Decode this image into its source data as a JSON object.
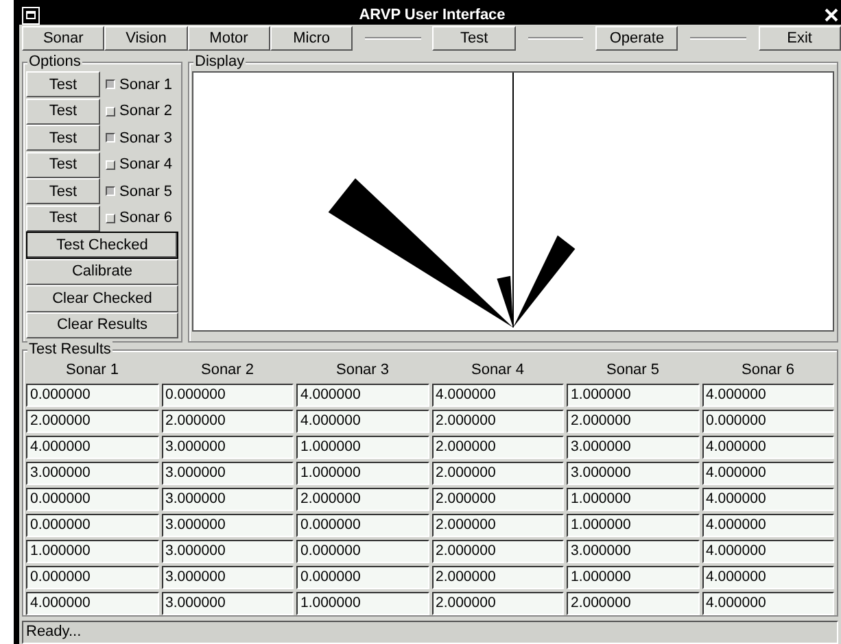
{
  "window": {
    "title": "ARVP User Interface"
  },
  "toolbar": [
    {
      "kind": "button",
      "label": "Sonar"
    },
    {
      "kind": "button",
      "label": "Vision"
    },
    {
      "kind": "button",
      "label": "Motor"
    },
    {
      "kind": "button",
      "label": "Micro"
    },
    {
      "kind": "separator"
    },
    {
      "kind": "button",
      "label": "Test"
    },
    {
      "kind": "separator"
    },
    {
      "kind": "button",
      "label": "Operate"
    },
    {
      "kind": "separator"
    },
    {
      "kind": "button",
      "label": "Exit"
    }
  ],
  "options": {
    "title": "Options",
    "sonars": [
      {
        "button": "Test",
        "label": "Sonar 1",
        "checked": true
      },
      {
        "button": "Test",
        "label": "Sonar 2",
        "checked": false
      },
      {
        "button": "Test",
        "label": "Sonar 3",
        "checked": true
      },
      {
        "button": "Test",
        "label": "Sonar 4",
        "checked": false
      },
      {
        "button": "Test",
        "label": "Sonar 5",
        "checked": true
      },
      {
        "button": "Test",
        "label": "Sonar 6",
        "checked": false
      }
    ],
    "actions": [
      {
        "label": "Test Checked",
        "focused": true
      },
      {
        "label": "Calibrate",
        "focused": false
      },
      {
        "label": "Clear Checked",
        "focused": false
      },
      {
        "label": "Clear Results",
        "focused": false
      }
    ]
  },
  "display": {
    "title": "Display"
  },
  "results": {
    "title": "Test Results",
    "columns": [
      "Sonar 1",
      "Sonar 2",
      "Sonar 3",
      "Sonar 4",
      "Sonar 5",
      "Sonar 6"
    ],
    "rows": [
      [
        "0.000000",
        "0.000000",
        "4.000000",
        "4.000000",
        "1.000000",
        "4.000000"
      ],
      [
        "2.000000",
        "2.000000",
        "4.000000",
        "2.000000",
        "2.000000",
        "0.000000"
      ],
      [
        "4.000000",
        "3.000000",
        "1.000000",
        "2.000000",
        "3.000000",
        "4.000000"
      ],
      [
        "3.000000",
        "3.000000",
        "1.000000",
        "2.000000",
        "3.000000",
        "4.000000"
      ],
      [
        "0.000000",
        "3.000000",
        "2.000000",
        "2.000000",
        "1.000000",
        "4.000000"
      ],
      [
        "0.000000",
        "3.000000",
        "0.000000",
        "2.000000",
        "1.000000",
        "4.000000"
      ],
      [
        "1.000000",
        "3.000000",
        "0.000000",
        "2.000000",
        "3.000000",
        "4.000000"
      ],
      [
        "0.000000",
        "3.000000",
        "0.000000",
        "2.000000",
        "1.000000",
        "4.000000"
      ],
      [
        "4.000000",
        "3.000000",
        "1.000000",
        "2.000000",
        "2.000000",
        "4.000000"
      ]
    ]
  },
  "status_bar": "Ready..."
}
